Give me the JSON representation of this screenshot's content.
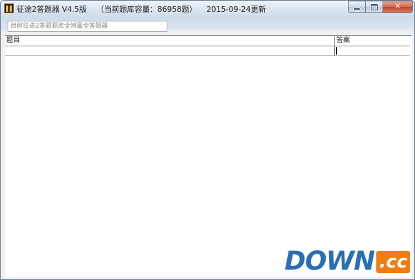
{
  "window": {
    "title_app": "征途2答题器 V4.5版",
    "title_capacity": "（当前题库容量：86958题）",
    "title_date": "2015-09-24更新"
  },
  "controls": {
    "minimize_icon": "minimize-icon",
    "maximize_icon": "maximize-icon",
    "close_icon": "close-icon",
    "close_glyph": "✕"
  },
  "search": {
    "placeholder": "目前征途2答题题库全网最全答题器"
  },
  "list": {
    "columns": [
      "题目",
      "答案"
    ],
    "rows": [
      {
        "question": "",
        "answer": ""
      }
    ]
  },
  "watermark": {
    "brand": "DOWN",
    "suffix": ".cc"
  },
  "colors": {
    "watermark_blue": "#2a6fb3",
    "watermark_orange": "#f07d12",
    "close_red": "#c4452b"
  }
}
